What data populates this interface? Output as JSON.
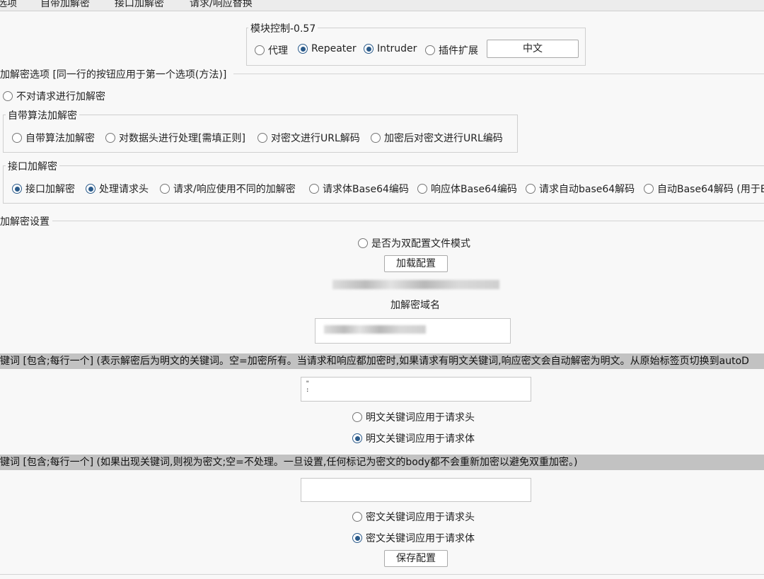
{
  "tabs": [
    "选项",
    "自带加解密",
    "接口加解密",
    "请求/响应替换"
  ],
  "module_control": {
    "title": "模块控制-0.57",
    "options": [
      {
        "label": "代理",
        "checked": false
      },
      {
        "label": "Repeater",
        "checked": true
      },
      {
        "label": "Intruder",
        "checked": true
      },
      {
        "label": "插件扩展",
        "checked": false
      }
    ],
    "language_button": "中文"
  },
  "crypto_options": {
    "title": "加解密选项 [同一行的按钮应用于第一个选项(方法)]",
    "no_crypto": {
      "label": "不对请求进行加解密",
      "checked": false
    },
    "builtin": {
      "title": "自带算法加解密",
      "options": [
        {
          "label": "自带算法加解密",
          "checked": false
        },
        {
          "label": "对数据头进行处理[需填正则]",
          "checked": false
        },
        {
          "label": "对密文进行URL解码",
          "checked": false
        },
        {
          "label": "加密后对密文进行URL编码",
          "checked": false
        }
      ]
    },
    "interface": {
      "title": "接口加解密",
      "options": [
        {
          "label": "接口加解密",
          "checked": true
        },
        {
          "label": "处理请求头",
          "checked": true
        },
        {
          "label": "请求/响应使用不同的加解密",
          "checked": false
        },
        {
          "label": "请求体Base64编码",
          "checked": false
        },
        {
          "label": "响应体Base64编码",
          "checked": false
        },
        {
          "label": "请求自动base64解码",
          "checked": false
        },
        {
          "label": "自动Base64解码 (用于B",
          "checked": false
        }
      ]
    }
  },
  "settings": {
    "title": "加解密设置",
    "dual_config": {
      "label": "是否为双配置文件模式",
      "checked": false
    },
    "load_button": "加载配置",
    "domain_label": "加解密域名",
    "plaintext_bar": "键词 [包含;每行一个] (表示解密后为明文的关键词。空=加密所有。当请求和响应都加密时,如果请求有明文关键词,响应密文会自动解密为明文。从原始标签页切换到autoD",
    "plaintext_textarea": "\"\n:",
    "plaintext_options": [
      {
        "label": "明文关键词应用于请求头",
        "checked": false
      },
      {
        "label": "明文关键词应用于请求体",
        "checked": true
      }
    ],
    "ciphertext_bar": "键词 [包含;每行一个] (如果出现关键词,则视为密文;空=不处理。一旦设置,任何标记为密文的body都不会重新加密以避免双重加密。)",
    "ciphertext_options": [
      {
        "label": "密文关键词应用于请求头",
        "checked": false
      },
      {
        "label": "密文关键词应用于请求体",
        "checked": true
      }
    ],
    "save_button": "保存配置"
  }
}
